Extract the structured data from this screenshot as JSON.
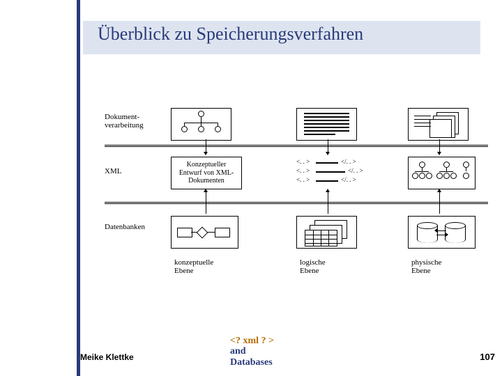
{
  "title": "Überblick zu Speicherungsverfahren",
  "rows": {
    "r1": "Dokument-\nverarbeitung",
    "r2": "XML",
    "r3": "Datenbanken"
  },
  "cols": {
    "c1": "konzeptuelle\nEbene",
    "c2": "logische\nEbene",
    "c3": "physische\nEbene"
  },
  "cells": {
    "xml_concept": "Konzeptueller\nEntwurf von XML-\nDokumenten",
    "xml_logic_l1a": "<. . >",
    "xml_logic_l1b": "</. . >",
    "xml_logic_l2a": "<. . >",
    "xml_logic_l2b": "</. . >",
    "xml_logic_l3a": "<. . >",
    "xml_logic_l3b": "</. . >"
  },
  "footer": {
    "author": "Meike Klettke",
    "page": "107",
    "logo1": "<? xml ? >",
    "logo2": "and",
    "logo3": "Databases"
  }
}
